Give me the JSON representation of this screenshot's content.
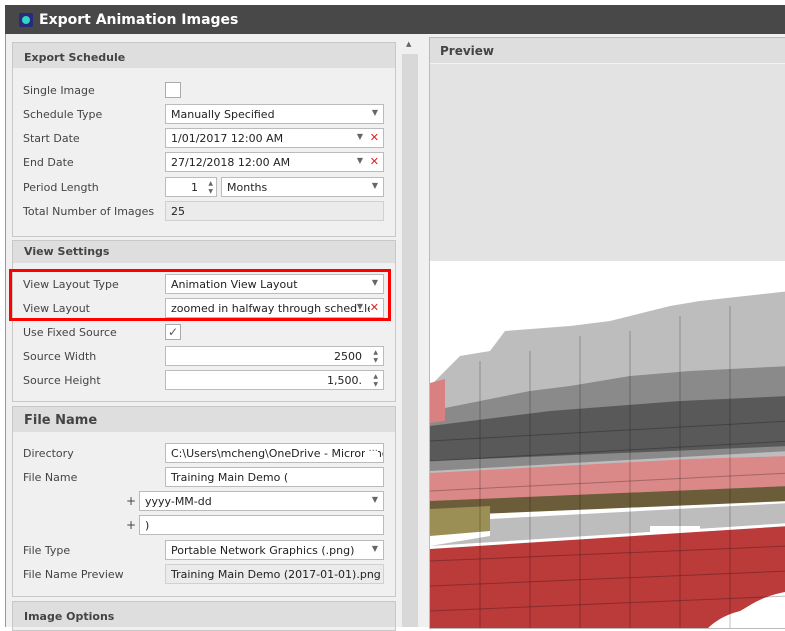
{
  "window": {
    "title": "Export Animation Images"
  },
  "export_schedule": {
    "header": "Export Schedule",
    "single_image": {
      "label": "Single Image",
      "checked": false
    },
    "schedule_type": {
      "label": "Schedule Type",
      "value": "Manually Specified"
    },
    "start_date": {
      "label": "Start Date",
      "value": "1/01/2017 12:00 AM"
    },
    "end_date": {
      "label": "End Date",
      "value": "27/12/2018 12:00 AM"
    },
    "period_length": {
      "label": "Period Length",
      "value": "1",
      "unit": "Months"
    },
    "total_images": {
      "label": "Total Number of Images",
      "value": "25"
    }
  },
  "view_settings": {
    "header": "View Settings",
    "view_layout_type": {
      "label": "View Layout Type",
      "value": "Animation View Layout"
    },
    "view_layout": {
      "label": "View Layout",
      "value": "zoomed in halfway through schedule"
    },
    "use_fixed_source": {
      "label": "Use Fixed Source",
      "checked": true,
      "mark": "✓"
    },
    "source_width": {
      "label": "Source Width",
      "value": "2500"
    },
    "source_height": {
      "label": "Source Height",
      "value": "1,500."
    }
  },
  "file_name": {
    "header": "File Name",
    "directory": {
      "label": "Directory",
      "value": "C:\\Users\\mcheng\\OneDrive - Micromine",
      "browse": "···"
    },
    "file_name": {
      "label": "File Name",
      "value": "Training Main Demo ("
    },
    "plus": "+",
    "date_format": {
      "value": "yyyy-MM-dd"
    },
    "suffix": {
      "value": ")"
    },
    "file_type": {
      "label": "File Type",
      "value": "Portable Network Graphics (.png)"
    },
    "preview": {
      "label": "File Name Preview",
      "value": "Training Main Demo (2017-01-01).png"
    }
  },
  "image_options": {
    "header": "Image Options"
  },
  "preview": {
    "header": "Preview"
  },
  "colors": {
    "title_bar": "#484848",
    "highlight": "#ff0000",
    "clear": "#e02020"
  }
}
